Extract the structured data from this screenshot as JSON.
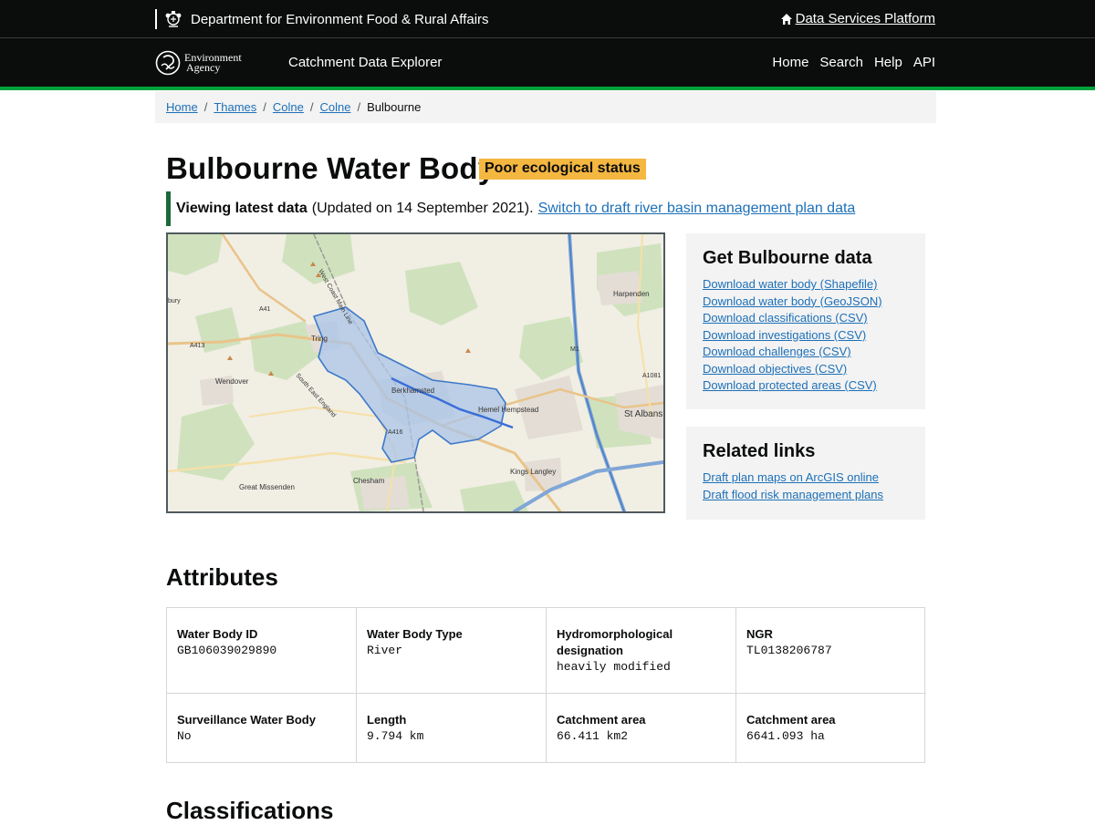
{
  "header": {
    "department": "Department for Environment Food & Rural Affairs",
    "platform_link": "Data Services Platform",
    "ea_logo_line1": "Environment",
    "ea_logo_line2": "Agency",
    "service_name": "Catchment Data Explorer",
    "nav": [
      "Home",
      "Search",
      "Help",
      "API"
    ]
  },
  "breadcrumb": {
    "items": [
      "Home",
      "Thames",
      "Colne",
      "Colne"
    ],
    "current": "Bulbourne"
  },
  "page": {
    "title": "Bulbourne Water Body",
    "status": "Poor ecological status",
    "inset_bold": "Viewing latest data",
    "inset_text": "(Updated on 14 September 2021).",
    "inset_link": "Switch to draft river basin management plan data"
  },
  "map": {
    "labels": [
      "Harpenden",
      "Tring",
      "Wendover",
      "Berkhamsted",
      "Hemel Hempstead",
      "St Albans",
      "Kings Langley",
      "Chesham",
      "Great Missenden",
      "A41",
      "A413",
      "A416",
      "M1",
      "A1081",
      "West Coast Main Line",
      "South East England",
      "bury"
    ],
    "colors": {
      "catchment_fill": "#a9c4e8",
      "catchment_stroke": "#3d78c9",
      "river": "#3a6fd8"
    }
  },
  "get_data": {
    "title": "Get Bulbourne data",
    "links": [
      "Download water body (Shapefile)",
      "Download water body (GeoJSON)",
      "Download classifications (CSV)",
      "Download investigations (CSV)",
      "Download challenges (CSV)",
      "Download objectives (CSV)",
      "Download protected areas (CSV)"
    ]
  },
  "related": {
    "title": "Related links",
    "links": [
      "Draft plan maps on ArcGIS online",
      "Draft flood risk management plans"
    ]
  },
  "attributes": {
    "title": "Attributes",
    "cells": [
      {
        "label": "Water Body ID",
        "value": "GB106039029890"
      },
      {
        "label": "Water Body Type",
        "value": "River"
      },
      {
        "label": "Hydromorphological designation",
        "value": "heavily modified"
      },
      {
        "label": "NGR",
        "value": "TL0138206787"
      },
      {
        "label": "Surveillance Water Body",
        "value": "No"
      },
      {
        "label": "Length",
        "value": "9.794 km"
      },
      {
        "label": "Catchment area",
        "value": "66.411 km2"
      },
      {
        "label": "Catchment area",
        "value": "6641.093 ha"
      }
    ]
  },
  "classifications": {
    "title": "Classifications"
  }
}
